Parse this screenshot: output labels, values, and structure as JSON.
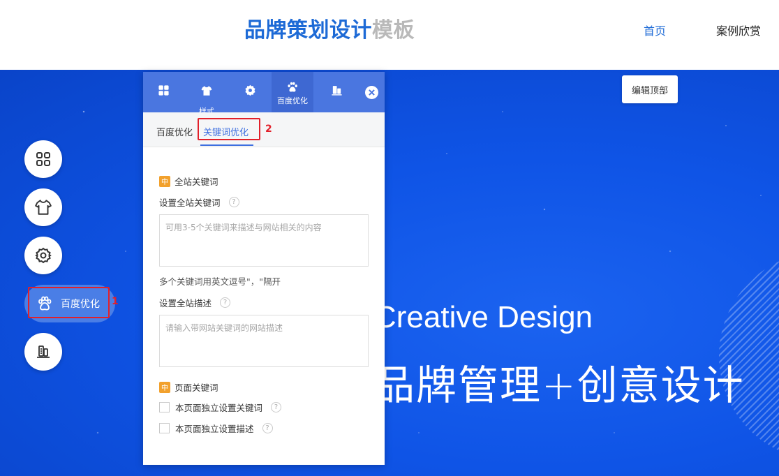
{
  "header": {
    "logo_part1": "品牌策划设计",
    "logo_part2": "模板",
    "nav": [
      {
        "label": "首页"
      },
      {
        "label": "案例欣赏"
      }
    ]
  },
  "hero": {
    "title_en": "Creative Design",
    "title_cn": "品牌管理+创意设计",
    "edit_top_label": "编辑顶部"
  },
  "sidebar": {
    "items": [
      {
        "icon": "grid-icon"
      },
      {
        "icon": "shirt-icon"
      },
      {
        "icon": "gear-icon"
      },
      {
        "icon": "paw-icon",
        "label": "百度优化",
        "active": true
      },
      {
        "icon": "building-icon"
      }
    ],
    "annotation": "1"
  },
  "panel": {
    "tabs": [
      {
        "icon": "grid-icon"
      },
      {
        "icon": "shirt-icon",
        "label": "样式"
      },
      {
        "icon": "gear-icon"
      },
      {
        "icon": "paw-icon",
        "label": "百度优化",
        "active": true
      },
      {
        "icon": "building-icon"
      }
    ],
    "subtabs": [
      {
        "label": "百度优化"
      },
      {
        "label": "关键词优化",
        "active": true
      }
    ],
    "annotation": "2",
    "site_keywords": {
      "badge": "中",
      "title": "全站关键词",
      "field_label": "设置全站关键词",
      "placeholder": "可用3-5个关键词来描述与网站相关的内容",
      "hint": "多个关键词用英文逗号\"，\"隔开"
    },
    "site_description": {
      "field_label": "设置全站描述",
      "placeholder": "请输入带网站关键词的网站描述"
    },
    "page_keywords": {
      "badge": "中",
      "title": "页面关键词",
      "check1": "本页面独立设置关键词",
      "check2": "本页面独立设置描述"
    },
    "help_glyph": "?"
  },
  "colors": {
    "accent": "#1d6ad6",
    "panel_tabs": "#4a76e0",
    "hero": "#0f54e6",
    "badge": "#f2a12d",
    "annotation": "#e2202a"
  }
}
